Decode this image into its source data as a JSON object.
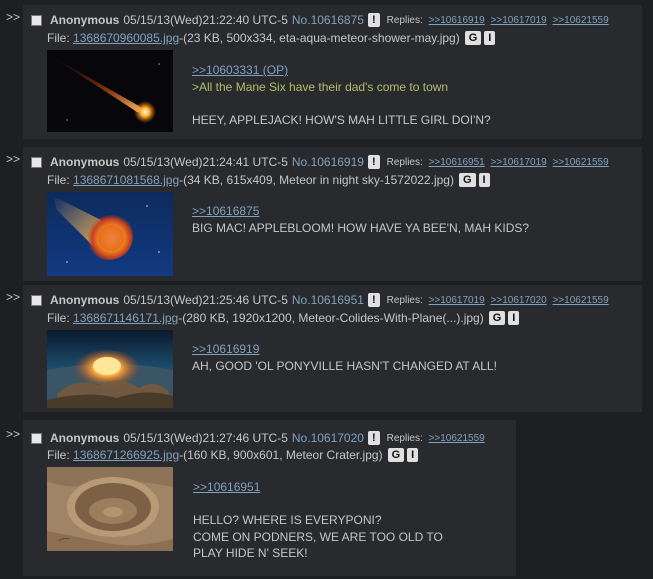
{
  "posts": [
    {
      "name": "Anonymous",
      "date": "05/15/13(Wed)21:22:40 UTC-5",
      "no": "No.10616875",
      "flag_btn": "!",
      "replies_label": "Replies:",
      "replies": [
        ">>10616919",
        ">>10617019",
        ">>10621559"
      ],
      "file_label": "File:",
      "file_name": "1368670960085.jpg",
      "file_info": "-(23 KB, 500x334, eta-aqua-meteor-shower-may.jpg)",
      "g_btn": "G",
      "i_btn": "I",
      "quote": ">>10603331 (OP)",
      "greentext": ">All the Mane Six have their dad's come to town",
      "text": "HEEY, APPLEJACK! HOW'S MAH LITTLE GIRL DOI'N?"
    },
    {
      "name": "Anonymous",
      "date": "05/15/13(Wed)21:24:41 UTC-5",
      "no": "No.10616919",
      "flag_btn": "!",
      "replies_label": "Replies:",
      "replies": [
        ">>10616951",
        ">>10617019",
        ">>10621559"
      ],
      "file_label": "File:",
      "file_name": "1368671081568.jpg",
      "file_info": "-(34 KB, 615x409, Meteor in night sky-1572022.jpg)",
      "g_btn": "G",
      "i_btn": "I",
      "quote": ">>10616875",
      "text": "BIG MAC! APPLEBLOOM! HOW HAVE YA BEE'N, MAH KIDS?"
    },
    {
      "name": "Anonymous",
      "date": "05/15/13(Wed)21:25:46 UTC-5",
      "no": "No.10616951",
      "flag_btn": "!",
      "replies_label": "Replies:",
      "replies": [
        ">>10617019",
        ">>10617020",
        ">>10621559"
      ],
      "file_label": "File:",
      "file_name": "1368671146171.jpg",
      "file_info": "-(280 KB, 1920x1200, Meteor-Colides-With-Plane(...).jpg)",
      "g_btn": "G",
      "i_btn": "I",
      "quote": ">>10616919",
      "text": "AH, GOOD 'OL PONYVILLE HASN'T CHANGED AT ALL!"
    },
    {
      "name": "Anonymous",
      "date": "05/15/13(Wed)21:27:46 UTC-5",
      "no": "No.10617020",
      "flag_btn": "!",
      "replies_label": "Replies:",
      "replies": [
        ">>10621559"
      ],
      "file_label": "File:",
      "file_name": "1368671266925.jpg",
      "file_info": "-(160 KB, 900x601, Meteor Crater.jpg)",
      "g_btn": "G",
      "i_btn": "I",
      "quote": ">>10616951",
      "text_lines": [
        "HELLO? WHERE IS EVERYPONI?",
        "COME ON PODNERS, WE ARE TOO OLD TO",
        "PLAY HIDE N' SEEK!"
      ]
    }
  ],
  "arrow": ">>"
}
